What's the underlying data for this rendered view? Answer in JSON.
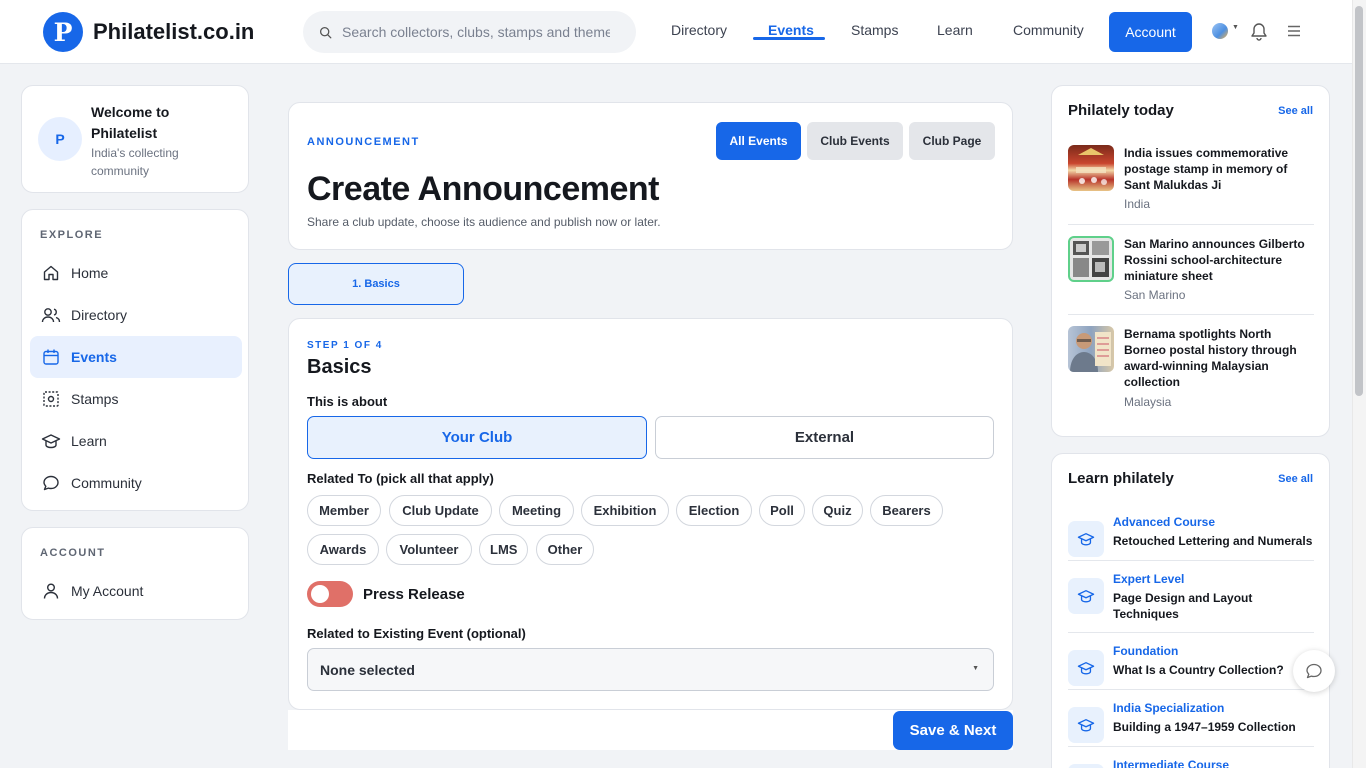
{
  "header": {
    "logo_letter": "P",
    "site_name": "Philatelist.co.in",
    "search_placeholder": "Search collectors, clubs, stamps and themes",
    "nav": [
      "Directory",
      "Events",
      "Stamps",
      "Learn",
      "Community"
    ],
    "active_nav": "Events",
    "account_label": "Account"
  },
  "sidebar": {
    "welcome_avatar": "P",
    "welcome_title": "Welcome to Philatelist",
    "welcome_sub": "India's collecting community",
    "explore_heading": "EXPLORE",
    "explore_items": [
      {
        "label": "Home",
        "icon": "home-icon"
      },
      {
        "label": "Directory",
        "icon": "users-icon"
      },
      {
        "label": "Events",
        "icon": "calendar-icon"
      },
      {
        "label": "Stamps",
        "icon": "stamp-icon"
      },
      {
        "label": "Learn",
        "icon": "graduation-cap-icon"
      },
      {
        "label": "Community",
        "icon": "chat-bubble-icon"
      }
    ],
    "active_item": "Events",
    "account_heading": "ACCOUNT",
    "account_items": [
      {
        "label": "My Account",
        "icon": "user-icon"
      }
    ]
  },
  "main": {
    "eyebrow": "ANNOUNCEMENT",
    "header_buttons": [
      "All Events",
      "Club Events",
      "Club Page"
    ],
    "title": "Create Announcement",
    "subtitle": "Share a club update, choose its audience and publish now or later.",
    "step_tab": "1. Basics",
    "step_label": "STEP 1 OF 4",
    "step_title": "Basics",
    "about_label": "This is about",
    "about_options": [
      "Your Club",
      "External"
    ],
    "about_selected": "Your Club",
    "related_label": "Related To (pick all that apply)",
    "related_chips": [
      "Member",
      "Club Update",
      "Meeting",
      "Exhibition",
      "Election",
      "Poll",
      "Quiz",
      "Bearers",
      "Awards",
      "Volunteer",
      "LMS",
      "Other"
    ],
    "press_release_label": "Press Release",
    "press_release_on": false,
    "existing_event_label": "Related to Existing Event (optional)",
    "existing_event_value": "None selected",
    "save_label": "Save & Next"
  },
  "right": {
    "today_title": "Philately today",
    "today_seeall": "See all",
    "news": [
      {
        "title": "India issues commemorative postage stamp in memory of Sant Malukdas Ji",
        "country": "India"
      },
      {
        "title": "San Marino announces Gilberto Rossini school-architecture miniature sheet",
        "country": "San Marino"
      },
      {
        "title": "Bernama spotlights North Borneo postal history through award-winning Malaysian collection",
        "country": "Malaysia"
      }
    ],
    "learn_title": "Learn philately",
    "learn_seeall": "See all",
    "learn": [
      {
        "level": "Advanced Course",
        "title": "Retouched Lettering and Numerals"
      },
      {
        "level": "Expert Level",
        "title": "Page Design and Layout Techniques"
      },
      {
        "level": "Foundation",
        "title": "What Is a Country Collection?"
      },
      {
        "level": "India Specialization",
        "title": "Building a 1947–1959 Collection"
      },
      {
        "level": "Intermediate Course",
        "title": ""
      }
    ]
  },
  "colors": {
    "accent": "#1767e8",
    "toggle_off": "#e07068"
  }
}
